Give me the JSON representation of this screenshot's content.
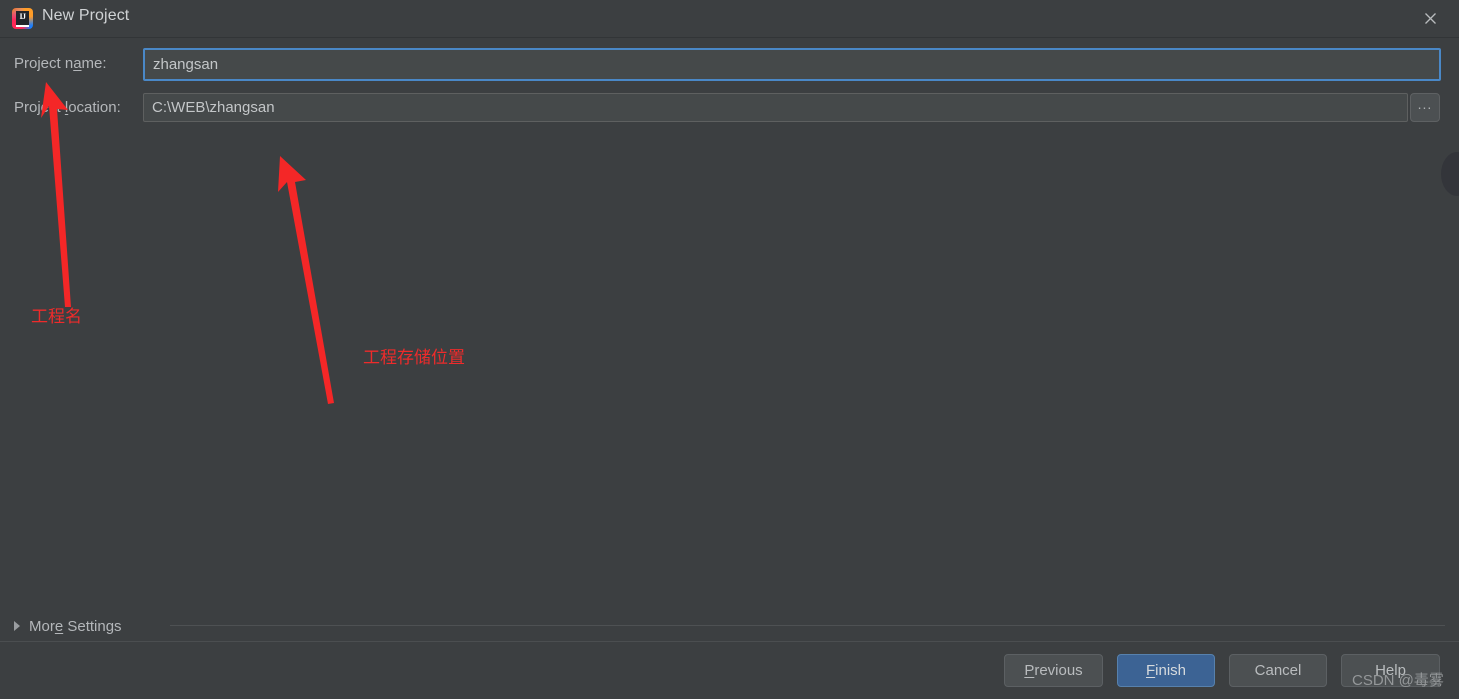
{
  "window": {
    "title": "New Project",
    "app_icon": "intellij-idea-logo",
    "icon_text": "IJ",
    "close_icon": "close-icon"
  },
  "form": {
    "name_label_pre": "Project n",
    "name_label_mnemonic": "a",
    "name_label_post": "me:",
    "name_value": "zhangsan",
    "location_label_pre": "Project ",
    "location_label_mnemonic": "l",
    "location_label_post": "ocation:",
    "location_value": "C:\\WEB\\zhangsan",
    "browse_label": "...",
    "browse_icon": "ellipsis-icon"
  },
  "annotations": {
    "project_name_note": "工程名",
    "project_location_note": "工程存储位置",
    "arrow_color": "#ee2b2b"
  },
  "more_settings": {
    "label_pre": "Mor",
    "label_mnemonic": "e",
    "label_post": " Settings",
    "expanded": false,
    "triangle_icon": "chevron-right-icon"
  },
  "buttons": {
    "previous": {
      "mnemonic": "P",
      "rest": "revious"
    },
    "finish": {
      "mnemonic": "F",
      "rest": "inish"
    },
    "cancel": {
      "mnemonic": "",
      "rest": "Cancel"
    },
    "help": {
      "mnemonic": "",
      "rest": "Help"
    }
  },
  "watermark": "CSDN @毒雾",
  "colors": {
    "background": "#3c3f41",
    "field_background": "#45494a",
    "focus_border": "#4a88c7",
    "primary_button": "#3c6394",
    "annotation_red": "#ee2b2b"
  }
}
